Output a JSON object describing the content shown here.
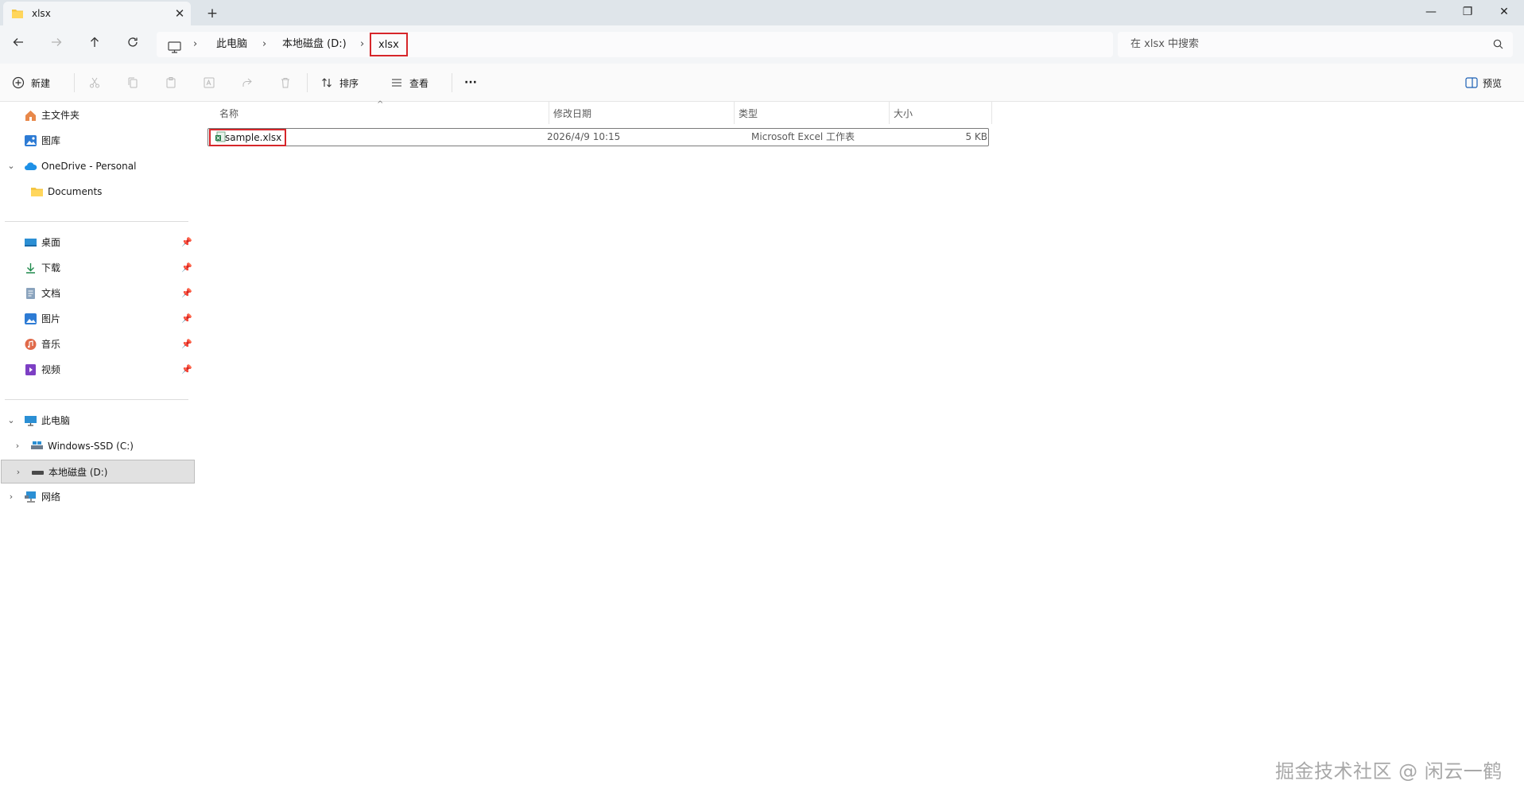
{
  "window": {
    "tab_title": "xlsx",
    "new_tab_label": "+",
    "close_tab_glyph": "✕",
    "minimize_glyph": "—",
    "maximize_glyph": "❐",
    "close_glyph": "✕"
  },
  "navigation": {
    "breadcrumbs": [
      "此电脑",
      "本地磁盘 (D:)",
      "xlsx"
    ],
    "separator": "›",
    "search_placeholder": "在 xlsx 中搜索"
  },
  "commandbar": {
    "new_label": "新建",
    "sort_label": "排序",
    "view_label": "查看",
    "more_label": "···",
    "preview_label": "预览",
    "disabled_actions": [
      "cut-icon",
      "copy-icon",
      "paste-icon",
      "rename-icon",
      "share-icon",
      "delete-icon"
    ]
  },
  "sidebar": {
    "quick": [
      {
        "label": "主文件夹",
        "icon": "home-icon"
      },
      {
        "label": "图库",
        "icon": "gallery-icon"
      },
      {
        "label": "OneDrive - Personal",
        "icon": "onedrive-icon",
        "expanded": true
      },
      {
        "label": "Documents",
        "icon": "folder-icon"
      }
    ],
    "pinned": [
      {
        "label": "桌面",
        "icon": "desktop-icon"
      },
      {
        "label": "下载",
        "icon": "download-icon"
      },
      {
        "label": "文档",
        "icon": "documents-icon"
      },
      {
        "label": "图片",
        "icon": "pictures-icon"
      },
      {
        "label": "音乐",
        "icon": "music-icon"
      },
      {
        "label": "视频",
        "icon": "videos-icon"
      }
    ],
    "devices": [
      {
        "label": "此电脑",
        "icon": "computer-icon",
        "expanded": true
      },
      {
        "label": "Windows-SSD (C:)",
        "icon": "drive-c-icon"
      },
      {
        "label": "本地磁盘 (D:)",
        "icon": "drive-d-icon",
        "selected": true
      },
      {
        "label": "网络",
        "icon": "network-icon"
      }
    ]
  },
  "filelist": {
    "columns": [
      "名称",
      "修改日期",
      "类型",
      "大小"
    ],
    "rows": [
      {
        "name": "sample.xlsx",
        "modified": "2026/4/9 10:15",
        "type": "Microsoft Excel 工作表",
        "size": "5 KB"
      }
    ]
  },
  "watermark": "掘金技术社区 @ 闲云一鹤",
  "colors": {
    "highlight": "#d6262a",
    "titlebar": "#dfe5ea",
    "selected_nav": "#e1e1e1"
  }
}
